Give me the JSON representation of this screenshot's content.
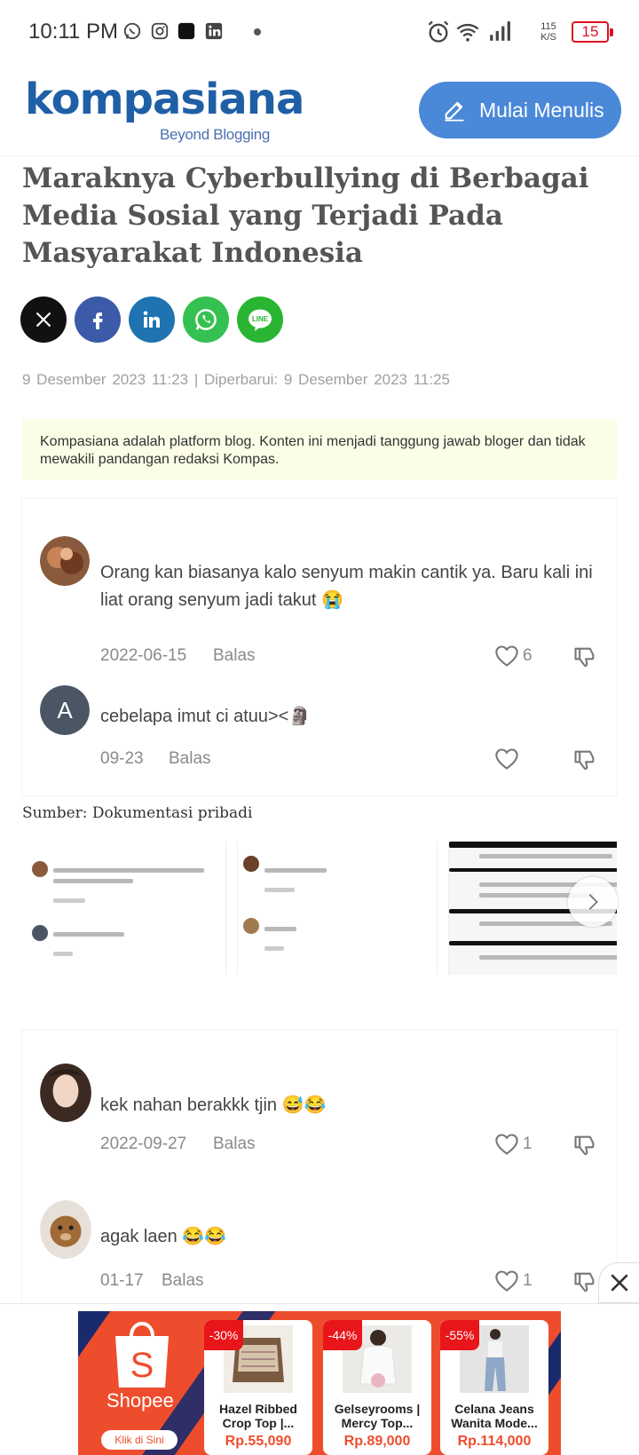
{
  "status_bar": {
    "time": "10:11 PM",
    "speed_value": "115",
    "speed_unit": "K/S",
    "battery": "15"
  },
  "header": {
    "logo_text": "kompasiana",
    "logo_tagline": "Beyond Blogging",
    "write_button": "Mulai Menulis"
  },
  "article": {
    "title": "Maraknya Cyberbullying di Berbagai Media Sosial yang Terjadi Pada Masyarakat Indonesia",
    "share": [
      "x-icon",
      "facebook-icon",
      "linkedin-icon",
      "whatsapp-icon",
      "line-icon"
    ],
    "share_line_label": "LINE",
    "meta": "9 Desember 2023   11:23 |  Diperbarui: 9 Desember 2023   11:25",
    "notice": "Kompasiana adalah platform blog. Konten ini menjadi tanggung jawab bloger dan tidak mewakili pandangan redaksi Kompas.",
    "caption": "Sumber: Dokumentasi pribadi"
  },
  "image1_comments": [
    {
      "text": "Orang kan biasanya kalo senyum makin cantik ya. Baru kali ini liat orang senyum jadi takut 😭",
      "date": "2022-06-15",
      "reply": "Balas",
      "likes": "6"
    },
    {
      "avatar_letter": "A",
      "text": "cebelapa imut ci atuu><🗿",
      "date": "09-23",
      "reply": "Balas",
      "likes": ""
    }
  ],
  "image2_comments": [
    {
      "text": "kek nahan berakkk tjin 😅😂",
      "date": "2022-09-27",
      "reply": "Balas",
      "likes": "1"
    },
    {
      "text": "agak laen 😂😂",
      "date": "01-17",
      "reply": "Balas",
      "likes": "1"
    }
  ],
  "ad": {
    "brand": "Shopee",
    "cta": "Klik di Sini",
    "products": [
      {
        "discount": "-30%",
        "name": "Hazel Ribbed Crop Top |...",
        "price": "Rp.55,090"
      },
      {
        "discount": "-44%",
        "name": "Gelseyrooms | Mercy Top...",
        "price": "Rp.89,000"
      },
      {
        "discount": "-55%",
        "name": "Celana Jeans Wanita Mode...",
        "price": "Rp.114,000"
      }
    ]
  },
  "colors": {
    "brand_blue": "#1f5fa6",
    "button_blue": "#4a88d8",
    "shopee_orange": "#ee4d2d",
    "notice_bg": "#fbfde6"
  }
}
